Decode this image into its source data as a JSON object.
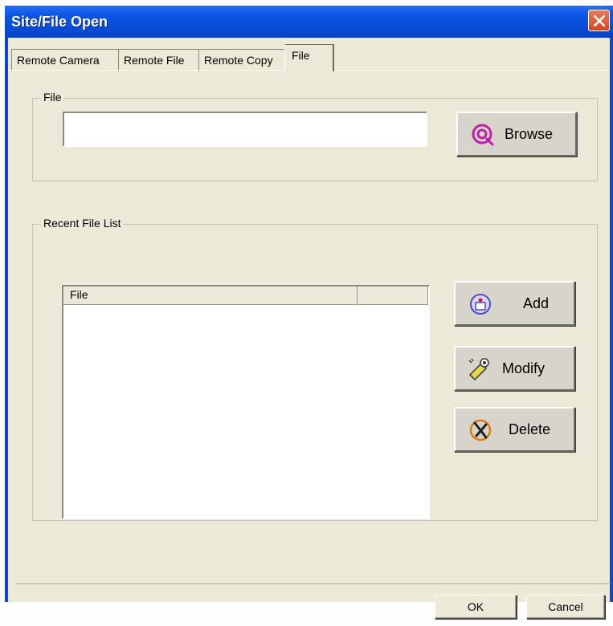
{
  "window": {
    "title": "Site/File Open"
  },
  "tabs": [
    "Remote Camera",
    "Remote File",
    "Remote Copy",
    "File"
  ],
  "file_group": {
    "label": "File",
    "path_value": "",
    "browse_label": "Browse"
  },
  "recent_group": {
    "label": "Recent File List",
    "columns": [
      "File",
      ""
    ],
    "rows": [],
    "add_label": "Add",
    "modify_label": "Modify",
    "delete_label": "Delete"
  },
  "footer": {
    "ok_label": "OK",
    "cancel_label": "Cancel"
  },
  "colors": {
    "titlebar": "#0a4bd6",
    "dialog_bg": "#ece9d8",
    "close": "#d8451f"
  }
}
